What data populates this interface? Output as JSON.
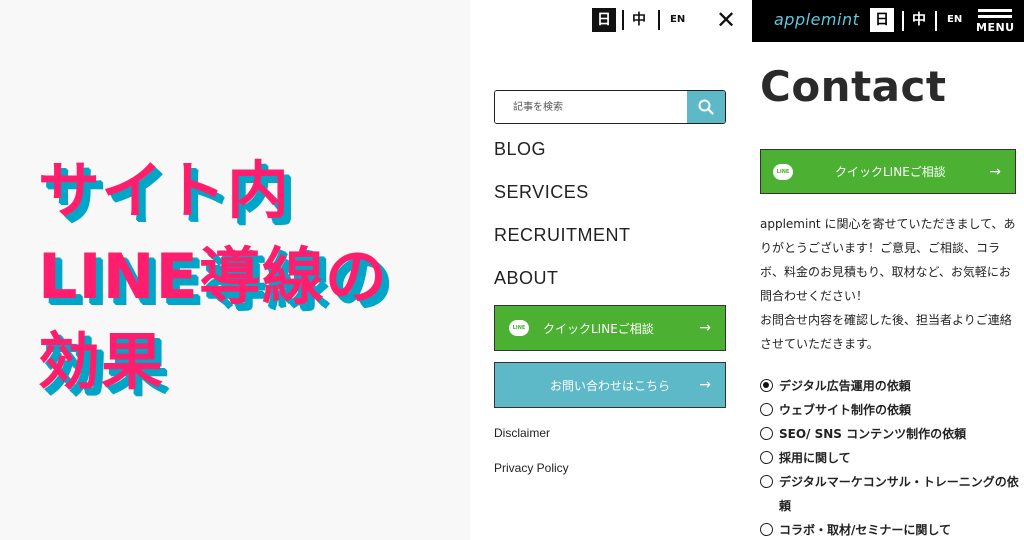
{
  "hero": {
    "lines": [
      "サイト内",
      "LINE導線の",
      "効果"
    ]
  },
  "menu_panel": {
    "lang": {
      "ja": "日",
      "zh": "中",
      "en": "EN"
    },
    "close_icon": "close-icon",
    "search": {
      "placeholder": "記事を検索",
      "icon": "search-icon"
    },
    "nav": [
      "BLOG",
      "SERVICES",
      "RECRUITMENT",
      "ABOUT"
    ],
    "line_button": {
      "badge": "LINE",
      "label": "クイックLINEご相談",
      "arrow": "→"
    },
    "contact_button": {
      "label": "お問い合わせはこちら",
      "arrow": "→"
    },
    "links": [
      "Disclaimer",
      "Privacy Policy"
    ]
  },
  "contact_panel": {
    "brand": "applemint",
    "lang": {
      "ja": "日",
      "zh": "中",
      "en": "EN"
    },
    "menu_label": "MENU",
    "title": "Contact",
    "line_button": {
      "badge": "LINE",
      "label": "クイックLINEご相談",
      "arrow": "→"
    },
    "intro": [
      "applemint に関心を寄せていただきまして、ありがとうございます！ご意見、ご相談、コラボ、料金のお見積もり、取材など、お気軽にお問合わせください！",
      "お問合せ内容を確認した後、担当者よりご連絡させていただきます。"
    ],
    "options": [
      {
        "label": "デジタル広告運用の依頼",
        "checked": true
      },
      {
        "label": "ウェブサイト制作の依頼",
        "checked": false
      },
      {
        "label": "SEO/ SNS コンテンツ制作の依頼",
        "checked": false
      },
      {
        "label": "採用に関して",
        "checked": false
      },
      {
        "label": "デジタルマーケコンサル・トレーニングの依頼",
        "checked": false
      },
      {
        "label": "コラボ・取材/セミナーに関して",
        "checked": false
      }
    ]
  },
  "colors": {
    "hero_text": "#ff1e6e",
    "hero_shadow": "#00a6c8",
    "line_green": "#4cb133",
    "contact_teal": "#5db8c8",
    "brand_cyan": "#5ec8dc"
  }
}
